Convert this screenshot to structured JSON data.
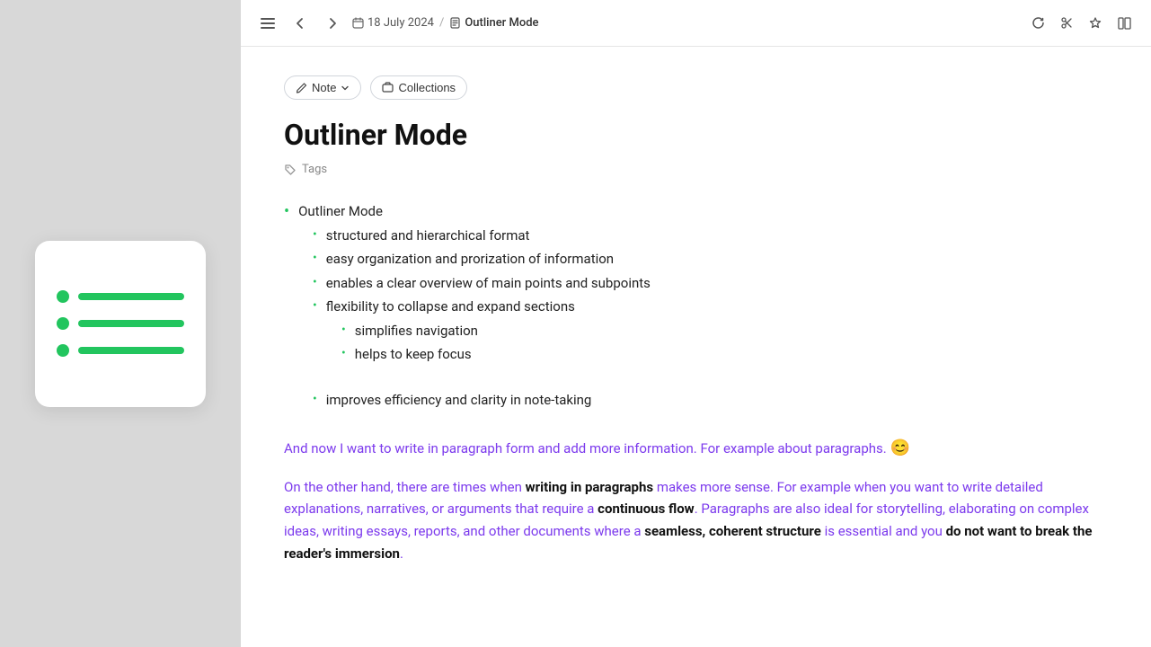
{
  "app": {
    "title": "Outliner Mode"
  },
  "toolbar": {
    "date": "18 July 2024",
    "breadcrumb_sep": "/",
    "page_title": "Outliner Mode",
    "back_label": "back",
    "forward_label": "forward",
    "sidebar_label": "sidebar"
  },
  "note_actions": {
    "note_btn_label": "Note",
    "collections_btn_label": "Collections"
  },
  "page": {
    "title": "Outliner Mode",
    "tags_label": "Tags"
  },
  "outliner": {
    "items": [
      {
        "level": 0,
        "text": "Outliner Mode",
        "children": [
          {
            "level": 1,
            "text": "structured and hierarchical format",
            "children": []
          },
          {
            "level": 1,
            "text": "easy organization and prorization of information",
            "children": []
          },
          {
            "level": 1,
            "text": "enables a clear overview of main points and subpoints",
            "children": []
          },
          {
            "level": 1,
            "text": "flexibility to collapse and expand sections",
            "children": [
              {
                "level": 2,
                "text": "simplifies navigation",
                "children": []
              },
              {
                "level": 2,
                "text": "helps to keep focus",
                "children": []
              }
            ]
          },
          {
            "level": 1,
            "text": "improves efficiency and clarity in note-taking",
            "children": []
          }
        ]
      }
    ]
  },
  "paragraphs": [
    {
      "id": "para1",
      "text_parts": [
        {
          "bold": false,
          "text": "And now I want to write in paragraph form and add more information. For example about paragraphs."
        },
        {
          "emoji": "😊"
        }
      ]
    },
    {
      "id": "para2",
      "text_parts": [
        {
          "bold": false,
          "text": "On the other hand, there are times when "
        },
        {
          "bold": true,
          "text": "writing in paragraphs"
        },
        {
          "bold": false,
          "text": " makes more sense. For example when you want to write detailed explanations, narratives, or arguments that require a "
        },
        {
          "bold": true,
          "text": "continuous flow"
        },
        {
          "bold": false,
          "text": ". Paragraphs are also ideal for storytelling, elaborating on complex ideas, writing essays, reports, and other documents where a "
        },
        {
          "bold": true,
          "text": "seamless, coherent structure"
        },
        {
          "bold": false,
          "text": " is essential and you "
        },
        {
          "bold": true,
          "text": "do not want to break the reader's immersion"
        },
        {
          "bold": false,
          "text": "."
        }
      ]
    }
  ],
  "illustration": {
    "rows": [
      {
        "bar_width": "85%"
      },
      {
        "bar_width": "85%"
      },
      {
        "bar_width": "85%"
      }
    ]
  }
}
